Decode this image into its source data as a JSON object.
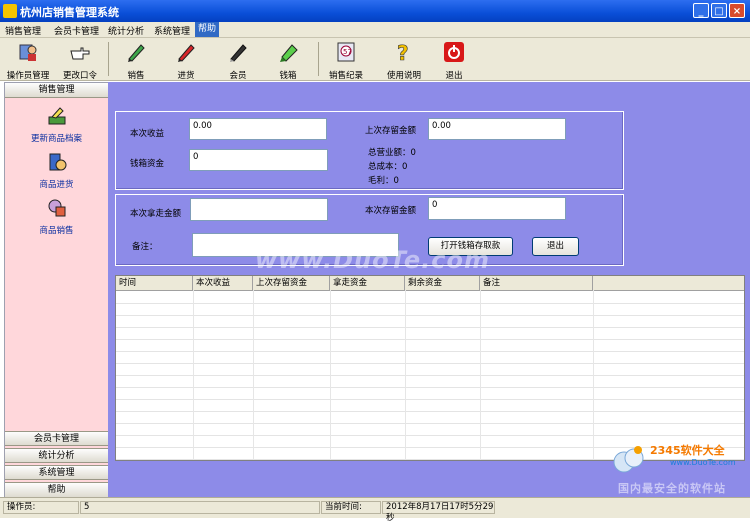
{
  "window": {
    "title": "杭州店销售管理系统"
  },
  "menu": [
    "销售管理",
    "会员卡管理",
    "统计分析",
    "系统管理",
    "帮助"
  ],
  "toolbar": [
    {
      "label": "操作员管理",
      "icon": "operator-icon"
    },
    {
      "label": "更改口令",
      "icon": "pointing-hand-icon"
    },
    {
      "label": "销售",
      "icon": "green-pen-icon"
    },
    {
      "label": "进货",
      "icon": "red-pen-icon"
    },
    {
      "label": "会员",
      "icon": "black-pen-icon"
    },
    {
      "label": "钱箱",
      "icon": "green-marker-icon"
    },
    {
      "label": "销售纪录",
      "icon": "records-icon"
    },
    {
      "label": "使用说明",
      "icon": "help-icon"
    },
    {
      "label": "退出",
      "icon": "power-icon"
    }
  ],
  "sidebar": {
    "header": "销售管理",
    "items": [
      {
        "label": "更新商品档案",
        "icon": "update-goods-icon"
      },
      {
        "label": "商品进货",
        "icon": "goods-purchase-icon"
      },
      {
        "label": "商品销售",
        "icon": "goods-sale-icon"
      }
    ],
    "bottom": [
      "会员卡管理",
      "统计分析",
      "系统管理",
      "帮助"
    ]
  },
  "form1": {
    "current_income_label": "本次收益",
    "current_income_value": "0.00",
    "cashbox_funds_label": "钱箱资金",
    "cashbox_funds_value": "0",
    "last_reserve_label": "上次存留金额",
    "last_reserve_value": "0.00",
    "total_revenue": "总营业额：0",
    "total_cost": "总成本：0",
    "gross_profit": "毛利：0"
  },
  "form2": {
    "take_amount_label": "本次拿走金额",
    "take_amount_value": "",
    "reserve_label": "本次存留金额",
    "reserve_value": "0",
    "note_label": "备注：",
    "note_value": "",
    "open_button": "打开钱箱存取款",
    "exit_button": "退出"
  },
  "table": {
    "columns": [
      "时间",
      "本次收益",
      "上次存留资金",
      "拿走资金",
      "剩余资金",
      "备注"
    ]
  },
  "status": {
    "operator_label": "操作员:",
    "operator_value": "5",
    "time_label": "当前时间:",
    "time_value": "2012年8月17日17时5分29秒"
  },
  "watermark": "www.DuoTe.com",
  "logo": {
    "brand": "2345软件大全",
    "url": "www.DuoTe.com",
    "slogan": "国内最安全的软件站"
  }
}
